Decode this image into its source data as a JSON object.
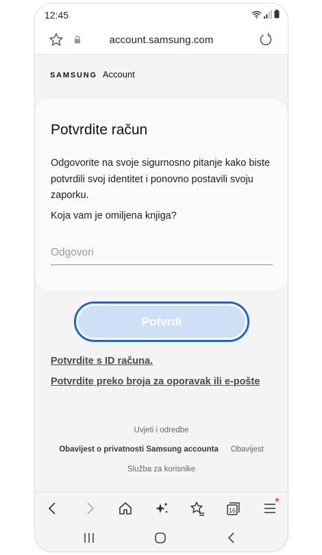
{
  "status_bar": {
    "time": "12:45"
  },
  "address_bar": {
    "url": "account.samsung.com"
  },
  "brand": {
    "samsung": "SAMSUNG",
    "account": "Account"
  },
  "card": {
    "title": "Potvrdite račun",
    "description": "Odgovorite na svoje sigurnosno pitanje kako biste potvrdili svoj identitet i ponovno postavili svoju zaporku.",
    "question": "Koja vam je omiljena knjiga?",
    "answer_placeholder": "Odgovori",
    "answer_value": ""
  },
  "confirm_button": {
    "label": "Potvrdi"
  },
  "links": {
    "verify_id": "Potvrdite s ID računa.",
    "verify_recovery": "Potvrdite preko broja za oporavak ili e-pošte"
  },
  "footer": {
    "terms": "Uvjeti i odredbe",
    "privacy": "Obavijest o privatnosti Samsung accounta",
    "notice": "Obavijest",
    "support": "Služba za korisnike"
  },
  "toolbar": {
    "tabs_count": "16"
  },
  "colors": {
    "accent": "#1b63d8",
    "button_fill": "#cfe0f6",
    "page_bg": "#f4f4f4",
    "badge": "#e46a1b"
  }
}
